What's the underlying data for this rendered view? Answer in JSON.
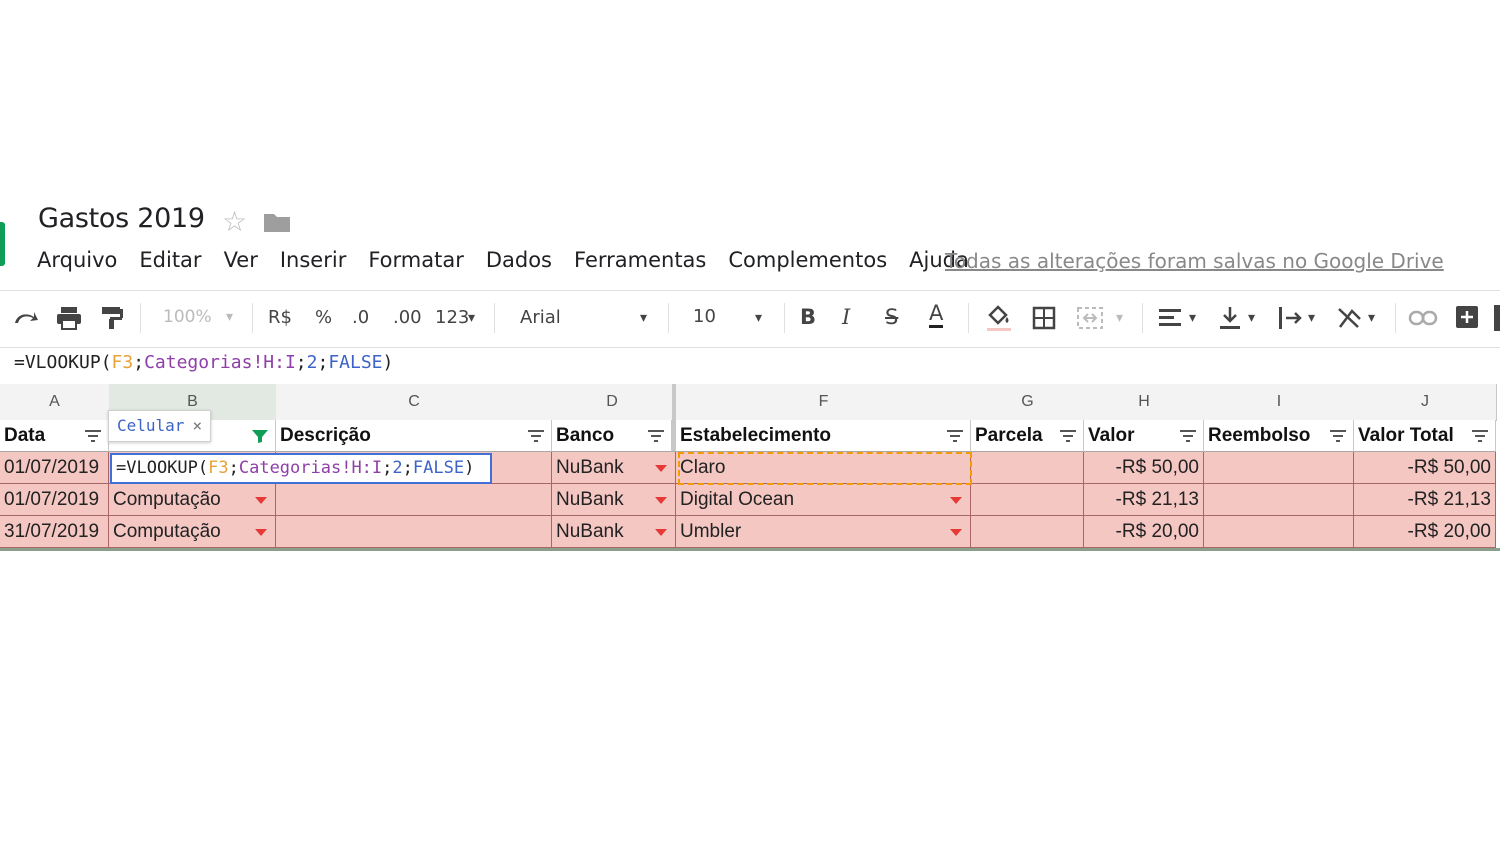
{
  "doc": {
    "title": "Gastos 2019"
  },
  "menu": [
    "Arquivo",
    "Editar",
    "Ver",
    "Inserir",
    "Formatar",
    "Dados",
    "Ferramentas",
    "Complementos",
    "Ajuda"
  ],
  "save_status": "Todas as alterações foram salvas no Google Drive",
  "toolbar": {
    "zoom": "100%",
    "currency": "R$",
    "percent": "%",
    "dec_minus": ".0",
    "dec_plus": ".00",
    "format_more": "123",
    "font": "Arial",
    "font_size": "10",
    "bold": "B",
    "italic": "I",
    "strike": "S",
    "text_color": "A"
  },
  "formula": {
    "prefix": "=VLOOKUP(",
    "ref": "F3",
    "sep1": ";",
    "range": "Categorias!H:I",
    "sep2": ";",
    "col": "2",
    "sep3": ";",
    "flag": "FALSE",
    "suffix": ")"
  },
  "columns": [
    "A",
    "B",
    "C",
    "D",
    "F",
    "G",
    "H",
    "I",
    "J"
  ],
  "headers": [
    "Data",
    "",
    "Descrição",
    "Banco",
    "Estabelecimento",
    "Parcela",
    "Valor",
    "Reembolso",
    "Valor Total"
  ],
  "chip": {
    "label": "Celular",
    "close": "×"
  },
  "rows": [
    [
      "01/07/2019",
      "",
      "",
      "NuBank",
      "Claro",
      "",
      "-R$ 50,00",
      "",
      "-R$ 50,00"
    ],
    [
      "01/07/2019",
      "Computação",
      "",
      "NuBank",
      "Digital Ocean",
      "",
      "-R$ 21,13",
      "",
      "-R$ 21,13"
    ],
    [
      "31/07/2019",
      "Computação",
      "",
      "NuBank",
      "Umbler",
      "",
      "-R$ 20,00",
      "",
      "-R$ 20,00"
    ]
  ],
  "colors": {
    "row_fill": "#f4c7c3",
    "accent_blue": "#3f6fd7",
    "green": "#0f9d58"
  }
}
